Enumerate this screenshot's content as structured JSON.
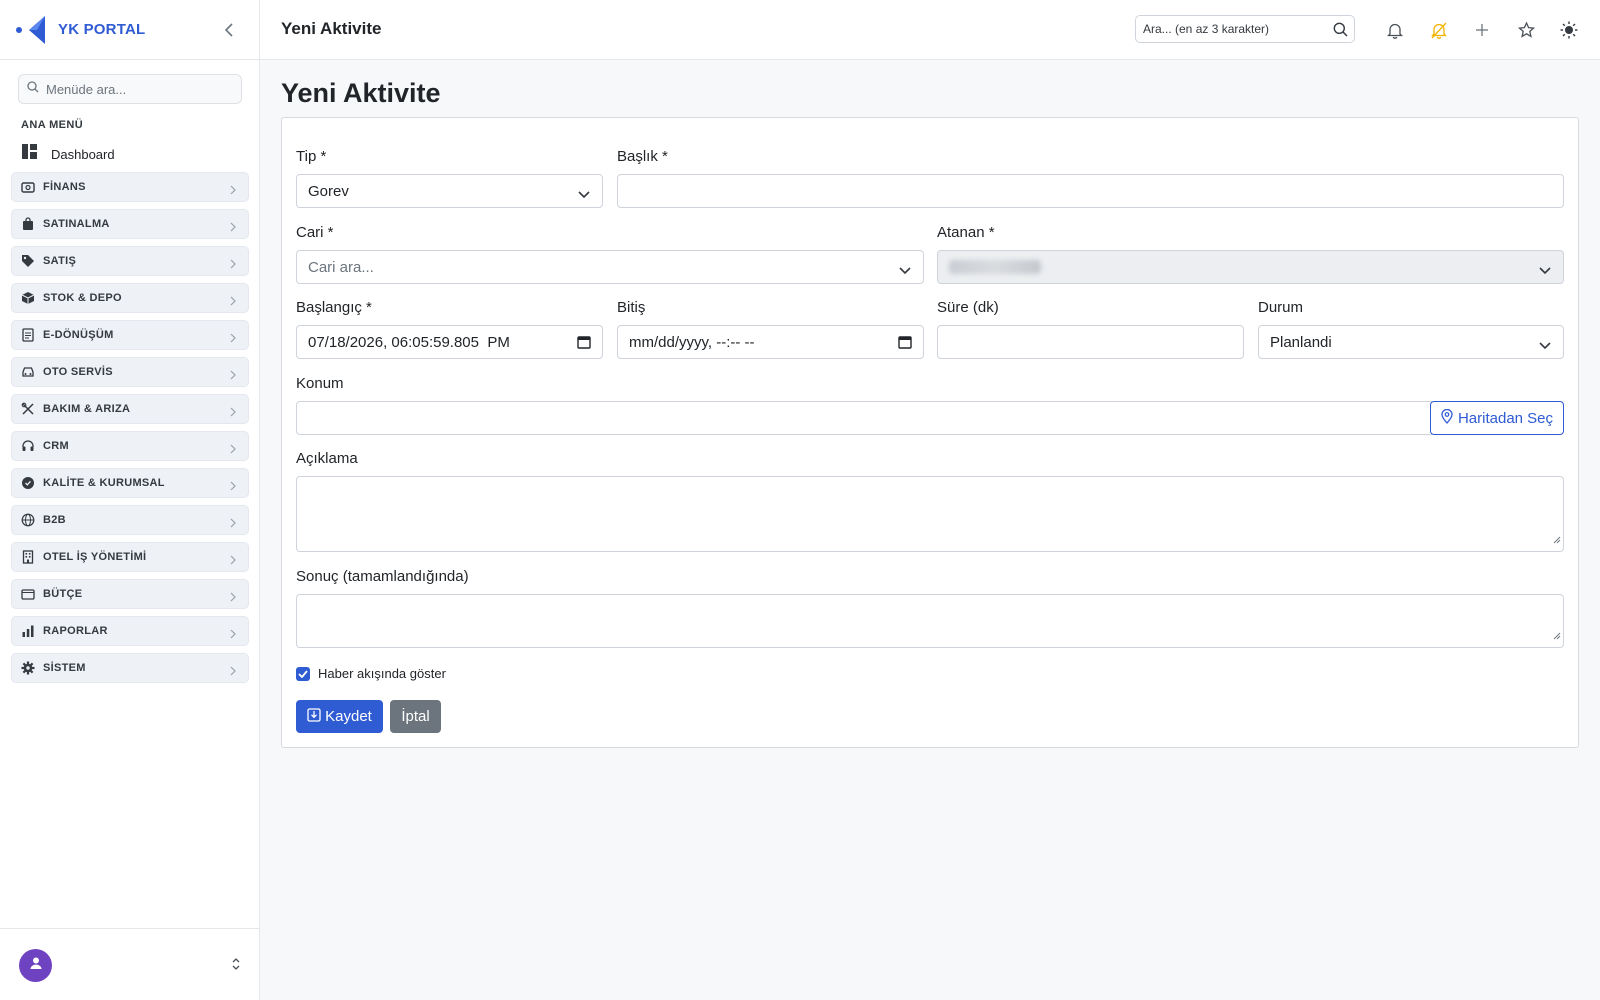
{
  "brand": {
    "name": "YK PORTAL"
  },
  "sidebar": {
    "search_placeholder": "Menüde ara...",
    "section_title": "ANA MENÜ",
    "dashboard_label": "Dashboard",
    "items": [
      {
        "label": "FİNANS",
        "icon": "finance-icon"
      },
      {
        "label": "SATINALMA",
        "icon": "bag-icon"
      },
      {
        "label": "SATIŞ",
        "icon": "tag-icon"
      },
      {
        "label": "STOK & DEPO",
        "icon": "box-icon"
      },
      {
        "label": "E-DÖNÜŞÜM",
        "icon": "document-icon"
      },
      {
        "label": "OTO SERVİS",
        "icon": "car-icon"
      },
      {
        "label": "BAKIM & ARIZA",
        "icon": "tools-icon"
      },
      {
        "label": "CRM",
        "icon": "headset-icon"
      },
      {
        "label": "KALİTE & KURUMSAL",
        "icon": "badge-check-icon"
      },
      {
        "label": "B2B",
        "icon": "globe-icon"
      },
      {
        "label": "OTEL İŞ YÖNETİMİ",
        "icon": "building-icon"
      },
      {
        "label": "BÜTÇE",
        "icon": "wallet-icon"
      },
      {
        "label": "RAPORLAR",
        "icon": "bar-chart-icon"
      },
      {
        "label": "SİSTEM",
        "icon": "gear-icon"
      }
    ]
  },
  "topbar": {
    "title": "Yeni Aktivite",
    "search_placeholder": "Ara... (en az 3 karakter)"
  },
  "colors": {
    "primary": "#2f5bd3",
    "secondary": "#6c757d",
    "accent_bell": "#f0b400"
  },
  "form": {
    "page_title": "Yeni Aktivite",
    "tip": {
      "label": "Tip *",
      "value": "Gorev"
    },
    "baslik": {
      "label": "Başlık *",
      "value": ""
    },
    "cari": {
      "label": "Cari *",
      "placeholder": "Cari ara..."
    },
    "atanan": {
      "label": "Atanan *"
    },
    "baslangic": {
      "label": "Başlangıç *",
      "value": "07/18/2026, 06:05:59.805  PM"
    },
    "bitis": {
      "label": "Bitiş",
      "value": "mm/dd/yyyy, --:-- --"
    },
    "sure": {
      "label": "Süre (dk)",
      "value": ""
    },
    "durum": {
      "label": "Durum",
      "value": "Planlandi"
    },
    "konum": {
      "label": "Konum",
      "value": "",
      "map_button": "Haritadan Seç"
    },
    "aciklama": {
      "label": "Açıklama"
    },
    "sonuc": {
      "label": "Sonuç (tamamlandığında)"
    },
    "news_checkbox": {
      "label": "Haber akışında göster",
      "checked": true
    },
    "save_label": "Kaydet",
    "cancel_label": "İptal"
  }
}
